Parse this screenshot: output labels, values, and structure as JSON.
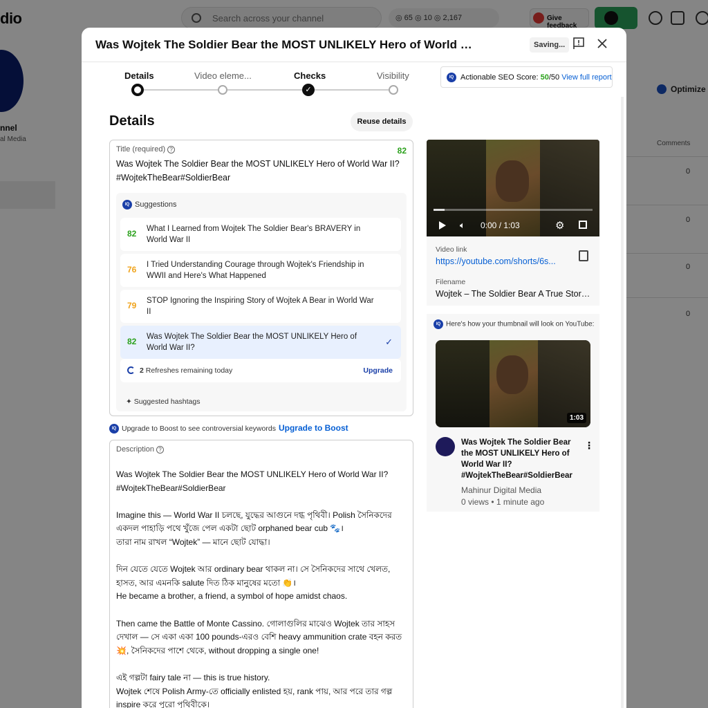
{
  "background": {
    "logo": "dio",
    "search_placeholder": "Search across your channel",
    "stats": "◎ 65  ◎ 10  ◎ 2,167",
    "feedback_label": "Give feedback",
    "channel_name": "nnel",
    "channel_sub": "al Media",
    "optimize_label": "Optimize",
    "comments_header": "Comments",
    "comment_counts": [
      "0",
      "0",
      "0",
      "0"
    ]
  },
  "modal": {
    "title": "Was Wojtek The Soldier Bear the MOST UNLIKELY Hero of World War II?#WojtekTheBear#SoldierBear",
    "saving_label": "Saving...",
    "steps": [
      {
        "label": "Details"
      },
      {
        "label": "Video eleme..."
      },
      {
        "label": "Checks"
      },
      {
        "label": "Visibility"
      }
    ],
    "seo": {
      "label": "Actionable SEO Score:",
      "score": "50",
      "total": "/50",
      "link": "View full report"
    },
    "section_heading": "Details",
    "reuse_button": "Reuse details",
    "title_field": {
      "label": "Title (required)",
      "score": "82",
      "value": "Was Wojtek The Soldier Bear the MOST UNLIKELY Hero of World War II? #WojtekTheBear#SoldierBear"
    },
    "suggestions": {
      "heading": "Suggestions",
      "items": [
        {
          "score": "82",
          "color": "#2ba11c",
          "text": "What I Learned from Wojtek The Soldier Bear's BRAVERY in World War II"
        },
        {
          "score": "76",
          "color": "#f0a31b",
          "text": "I Tried Understanding Courage through Wojtek's Friendship in WWII and Here's What Happened"
        },
        {
          "score": "79",
          "color": "#f0a31b",
          "text": "STOP Ignoring the Inspiring Story of Wojtek A Bear in World War II"
        },
        {
          "score": "82",
          "color": "#2ba11c",
          "text": "Was Wojtek The Soldier Bear the MOST UNLIKELY Hero of World War II?"
        }
      ],
      "refresh_count": "2",
      "refresh_text": "Refreshes remaining today",
      "upgrade_label": "Upgrade",
      "hashtags_label": "Suggested hashtags"
    },
    "boost": {
      "text": "Upgrade to Boost to see controversial keywords",
      "link": "Upgrade to Boost"
    },
    "description": {
      "label": "Description",
      "value": "Was Wojtek The Soldier Bear the MOST UNLIKELY Hero of World War II?\n#WojtekTheBear#SoldierBear\n\nImagine this — World War II চলছে, যুদ্ধের আগুনে দগ্ধ পৃথিবী। Polish সৈনিকদের একদল পাহাড়ি পথে খুঁজে পেল একটা ছোট orphaned bear cub 🐾।\nতারা নাম রাখল “Wojtek” — মানে ছোট যোদ্ধা।\n\nদিন যেতে যেতে Wojtek আর ordinary bear থাকল না। সে সৈনিকদের সাথে খেলত, হাসত, আর এমনকি salute দিত ঠিক মানুষের মতো 👏।\nHe became a brother, a friend, a symbol of hope amidst chaos.\n\nThen came the Battle of Monte Cassino. গোলাগুলির মাঝেও Wojtek তার সাহস দেখাল — সে একা একা 100 pounds-এরও বেশি heavy ammunition crate বহন করত 💥, সৈনিকদের পাশে থেকে, without dropping a single one!\n\nএই গল্পটা fairy tale না — this is true history.\nWojtek শেষে Polish Army-তে officially enlisted হয়, rank পায়, আর পরে তার গল্প inspire করে পুরো পৃথিবীকে।"
    },
    "video": {
      "time": "0:00 / 1:03",
      "link_label": "Video link",
      "link_value": "https://youtube.com/shorts/6s...",
      "filename_label": "Filename",
      "filename_value": "Wojtek – The Soldier Bear A True Story ..."
    },
    "thumbnail": {
      "heading": "Here's how your thumbnail will look on YouTube:",
      "duration": "1:03",
      "title": "Was Wojtek The Soldier Bear the MOST UNLIKELY Hero of World War II? #WojtekTheBear#SoldierBear",
      "channel": "Mahinur Digital Media",
      "meta": "0 views • 1 minute ago"
    }
  }
}
